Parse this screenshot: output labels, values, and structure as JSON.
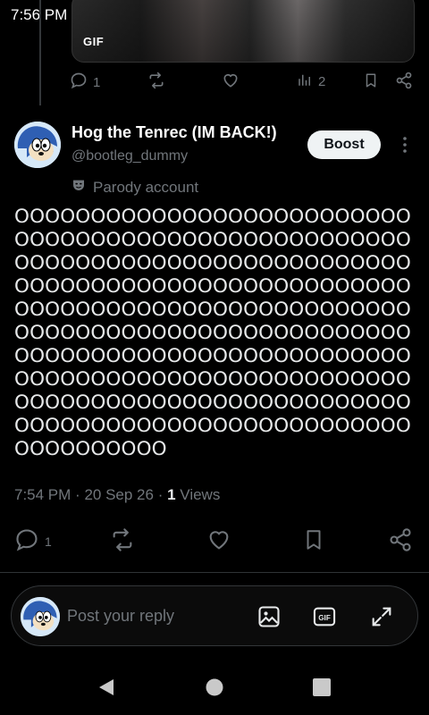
{
  "status_bar": {
    "time": "7:56 PM",
    "icons": [
      "mute-icon",
      "wifi-icon",
      "battery-icon"
    ]
  },
  "previous_tweet": {
    "media_badge": "GIF",
    "actions": {
      "reply_count": "1",
      "retweet_count": "",
      "like_count": "",
      "views_count": "2"
    }
  },
  "tweet": {
    "author_name": "Hog the Tenrec (IM BACK!)",
    "author_handle": "@bootleg_dummy",
    "boost_label": "Boost",
    "parody_label": "Parody account",
    "text": "OOOOOOOOOOOOOOOOOOOOOOOOOOOOOOOOOOOOOOOOOOOOOOOOOOOOOOOOOOOOOOOOOOOOOOOOOOOOOOOOOOOOOOOOOOOOOOOOOOOOOOOOOOOOOOOOOOOOOOOOOOOOOOOOOOOOOOOOOOOOOOOOOOOOOOOOOOOOOOOOOOOOOOOOOOOOOOOOOOOOOOOOOOOOOOOOOOOOOOOOOOOOOOOOOOOOOOOOOOOOOOOOOOOOOOOOOOOOOOOOOOOOOOOOOOOOOOOOOOOOOOOOOOOOOO",
    "time": "7:54 PM",
    "date": "20 Sep 26",
    "views_count": "1",
    "views_label": "Views",
    "reply_count": "1"
  },
  "reply_bar": {
    "placeholder": "Post your reply"
  },
  "colors": {
    "background": "#000000",
    "text_primary": "#e7e9ea",
    "text_secondary": "#71767b",
    "divider": "#2f3336",
    "button_bg": "#eff3f4"
  }
}
